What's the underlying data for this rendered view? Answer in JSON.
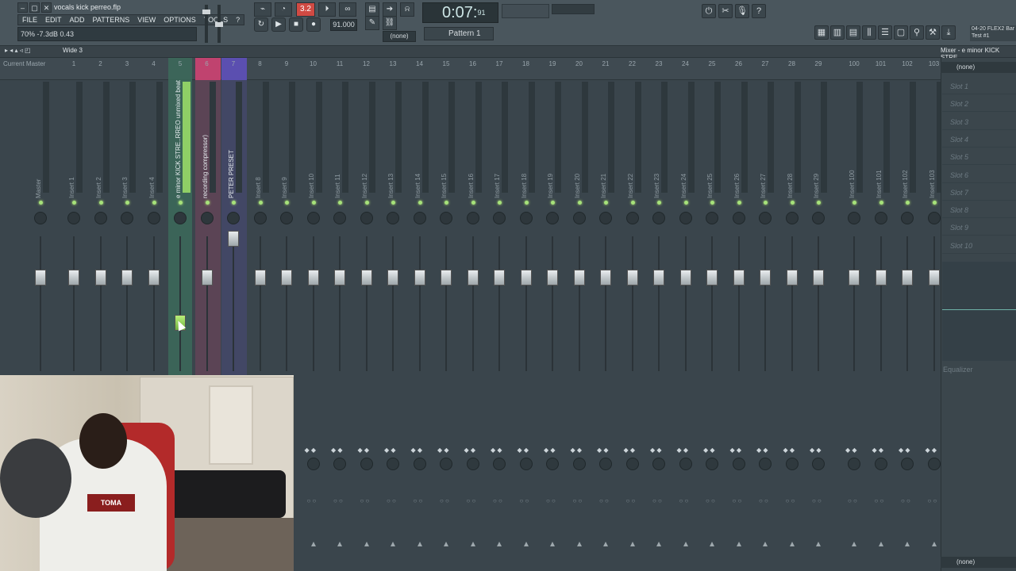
{
  "window": {
    "project_title": "vocals kick perreo.flp",
    "buttons": [
      "–",
      "▢",
      "✕"
    ]
  },
  "menu": [
    "FILE",
    "EDIT",
    "ADD",
    "PATTERNS",
    "VIEW",
    "OPTIONS",
    "TOOLS",
    "?"
  ],
  "hint": "70%  -7.3dB  0.43",
  "transport": {
    "time": "0:07:",
    "time_small": "91",
    "time_unit": "M:S:CS",
    "tempo": "91.000",
    "pattern": "Pattern 1",
    "snap": "(none)",
    "counter": "3.2"
  },
  "news": {
    "line1": "04-20 FLEX2 Bar",
    "line2": "Test #1"
  },
  "mixer": {
    "title": "Mixer - e minor KICK STRE",
    "layout": "Wide 3",
    "header_left": [
      "Current",
      "Master"
    ],
    "channels": [
      {
        "num": "",
        "label": "Master"
      },
      {
        "num": "1",
        "label": "Insert 1"
      },
      {
        "num": "2",
        "label": "Insert 2"
      },
      {
        "num": "3",
        "label": "Insert 3"
      },
      {
        "num": "4",
        "label": "Insert 4"
      },
      {
        "num": "5",
        "label": "e minor KICK STRE..RREO unmixed beat"
      },
      {
        "num": "6",
        "label": "recording compressor)"
      },
      {
        "num": "7",
        "label": "PETER PRESET"
      },
      {
        "num": "8",
        "label": "Insert 8"
      },
      {
        "num": "9",
        "label": "Insert 9"
      },
      {
        "num": "10",
        "label": "Insert 10"
      },
      {
        "num": "11",
        "label": "Insert 11"
      },
      {
        "num": "12",
        "label": "Insert 12"
      },
      {
        "num": "13",
        "label": "Insert 13"
      },
      {
        "num": "14",
        "label": "Insert 14"
      },
      {
        "num": "15",
        "label": "Insert 15"
      },
      {
        "num": "16",
        "label": "Insert 16"
      },
      {
        "num": "17",
        "label": "Insert 17"
      },
      {
        "num": "18",
        "label": "Insert 18"
      },
      {
        "num": "19",
        "label": "Insert 19"
      },
      {
        "num": "20",
        "label": "Insert 20"
      },
      {
        "num": "21",
        "label": "Insert 21"
      },
      {
        "num": "22",
        "label": "Insert 22"
      },
      {
        "num": "23",
        "label": "Insert 23"
      },
      {
        "num": "24",
        "label": "Insert 24"
      },
      {
        "num": "25",
        "label": "Insert 25"
      },
      {
        "num": "26",
        "label": "Insert 26"
      },
      {
        "num": "27",
        "label": "Insert 27"
      },
      {
        "num": "28",
        "label": "Insert 28"
      },
      {
        "num": "29",
        "label": "Insert 29"
      },
      {
        "num": "100",
        "label": "Insert 100"
      },
      {
        "num": "101",
        "label": "Insert 101"
      },
      {
        "num": "102",
        "label": "Insert 102"
      },
      {
        "num": "103",
        "label": "Insert 103"
      }
    ]
  },
  "effects": {
    "selector": "(none)",
    "slots": [
      "Slot 1",
      "Slot 2",
      "Slot 3",
      "Slot 4",
      "Slot 5",
      "Slot 6",
      "Slot 7",
      "Slot 8",
      "Slot 9",
      "Slot 10"
    ],
    "eq_label": "Equalizer",
    "output": "(none)"
  },
  "webcam": {
    "shirt_text": "TOMA"
  },
  "colors": {
    "selected_channel": "#3c6a5a",
    "channel_6": "#c0436f",
    "channel_7": "#5b4fb0",
    "led": "#a6e27a"
  }
}
